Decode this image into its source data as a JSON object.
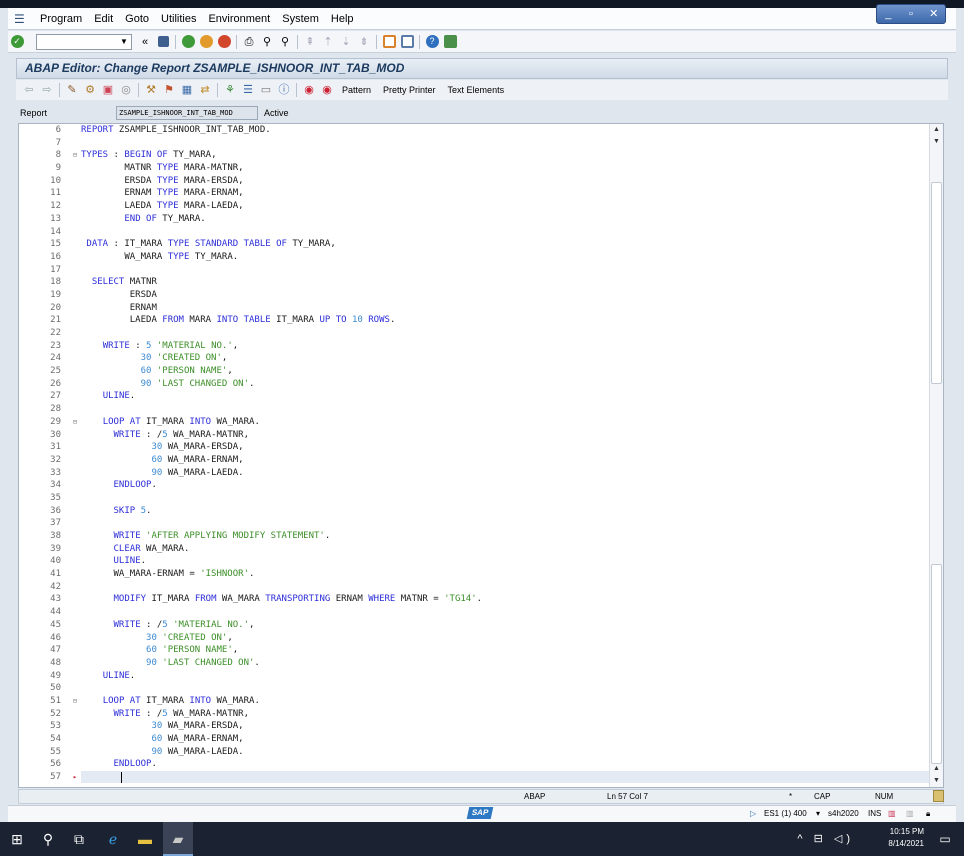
{
  "window": {
    "title": "ABAP Editor: Change Report ZSAMPLE_ISHNOOR_INT_TAB_MOD"
  },
  "menu": [
    "Program",
    "Edit",
    "Goto",
    "Utilities",
    "Environment",
    "System",
    "Help"
  ],
  "toolbar": {
    "command_value": "",
    "icons": [
      "enter-icon",
      "save-icon",
      "back-icon",
      "exit-icon",
      "cancel-icon",
      "print-icon",
      "find-icon",
      "find-next-icon",
      "first-page-icon",
      "prev-page-icon",
      "next-page-icon",
      "last-page-icon",
      "new-session-icon",
      "shortcut-icon",
      "help-icon",
      "layout-icon"
    ]
  },
  "app_toolbar": {
    "pattern": "Pattern",
    "pretty_printer": "Pretty Printer",
    "text_elements": "Text Elements"
  },
  "report": {
    "label": "Report",
    "name": "ZSAMPLE_ISHNOOR_INT_TAB_MOD",
    "status": "Active"
  },
  "code": [
    {
      "n": "6",
      "t": "REPORT ZSAMPLE_ISHNOOR_INT_TAB_MOD."
    },
    {
      "n": "7",
      "t": ""
    },
    {
      "n": "8",
      "t": "TYPES : BEGIN OF TY_MARA,",
      "fold": "⊟"
    },
    {
      "n": "9",
      "t": "        MATNR TYPE MARA-MATNR,"
    },
    {
      "n": "10",
      "t": "        ERSDA TYPE MARA-ERSDA,"
    },
    {
      "n": "11",
      "t": "        ERNAM TYPE MARA-ERNAM,"
    },
    {
      "n": "12",
      "t": "        LAEDA TYPE MARA-LAEDA,"
    },
    {
      "n": "13",
      "t": "        END OF TY_MARA."
    },
    {
      "n": "14",
      "t": ""
    },
    {
      "n": "15",
      "t": " DATA : IT_MARA TYPE STANDARD TABLE OF TY_MARA,"
    },
    {
      "n": "16",
      "t": "        WA_MARA TYPE TY_MARA."
    },
    {
      "n": "17",
      "t": ""
    },
    {
      "n": "18",
      "t": "  SELECT MATNR"
    },
    {
      "n": "19",
      "t": "         ERSDA"
    },
    {
      "n": "20",
      "t": "         ERNAM"
    },
    {
      "n": "21",
      "t": "         LAEDA FROM MARA INTO TABLE IT_MARA UP TO 10 ROWS."
    },
    {
      "n": "22",
      "t": ""
    },
    {
      "n": "23",
      "t": "    WRITE : 5 'MATERIAL NO.',"
    },
    {
      "n": "24",
      "t": "           30 'CREATED ON',"
    },
    {
      "n": "25",
      "t": "           60 'PERSON NAME',"
    },
    {
      "n": "26",
      "t": "           90 'LAST CHANGED ON'."
    },
    {
      "n": "27",
      "t": "    ULINE."
    },
    {
      "n": "28",
      "t": ""
    },
    {
      "n": "29",
      "t": "    LOOP AT IT_MARA INTO WA_MARA.",
      "fold": "⊟"
    },
    {
      "n": "30",
      "t": "      WRITE : /5 WA_MARA-MATNR,"
    },
    {
      "n": "31",
      "t": "             30 WA_MARA-ERSDA,"
    },
    {
      "n": "32",
      "t": "             60 WA_MARA-ERNAM,"
    },
    {
      "n": "33",
      "t": "             90 WA_MARA-LAEDA."
    },
    {
      "n": "34",
      "t": "      ENDLOOP."
    },
    {
      "n": "35",
      "t": ""
    },
    {
      "n": "36",
      "t": "      SKIP 5."
    },
    {
      "n": "37",
      "t": ""
    },
    {
      "n": "38",
      "t": "      WRITE 'AFTER APPLYING MODIFY STATEMENT'."
    },
    {
      "n": "39",
      "t": "      CLEAR WA_MARA."
    },
    {
      "n": "40",
      "t": "      ULINE."
    },
    {
      "n": "41",
      "t": "      WA_MARA-ERNAM = 'ISHNOOR'."
    },
    {
      "n": "42",
      "t": ""
    },
    {
      "n": "43",
      "t": "      MODIFY IT_MARA FROM WA_MARA TRANSPORTING ERNAM WHERE MATNR = 'TG14'."
    },
    {
      "n": "44",
      "t": ""
    },
    {
      "n": "45",
      "t": "      WRITE : /5 'MATERIAL NO.',"
    },
    {
      "n": "46",
      "t": "            30 'CREATED ON',"
    },
    {
      "n": "47",
      "t": "            60 'PERSON NAME',"
    },
    {
      "n": "48",
      "t": "            90 'LAST CHANGED ON'."
    },
    {
      "n": "49",
      "t": "    ULINE."
    },
    {
      "n": "50",
      "t": ""
    },
    {
      "n": "51",
      "t": "    LOOP AT IT_MARA INTO WA_MARA.",
      "fold": "⊟"
    },
    {
      "n": "52",
      "t": "      WRITE : /5 WA_MARA-MATNR,"
    },
    {
      "n": "53",
      "t": "             30 WA_MARA-ERSDA,"
    },
    {
      "n": "54",
      "t": "             60 WA_MARA-ERNAM,"
    },
    {
      "n": "55",
      "t": "             90 WA_MARA-LAEDA."
    },
    {
      "n": "56",
      "t": "      ENDLOOP."
    },
    {
      "n": "57",
      "t": "",
      "current": true
    }
  ],
  "editor_status": {
    "lang": "ABAP",
    "pos": "Ln  57 Col   7",
    "ins": "*",
    "cap": "CAP",
    "num": "NUM"
  },
  "sap_status": {
    "logo": "SAP",
    "system": "ES1 (1) 400",
    "server": "s4h2020",
    "mode": "INS"
  },
  "taskbar": {
    "time": "10:15 PM",
    "date": "8/14/2021"
  },
  "colors": {
    "keyword": "#2d2ed8",
    "string": "#3c8f28",
    "number": "#3c8ad2",
    "title": "#1c3a5e"
  }
}
